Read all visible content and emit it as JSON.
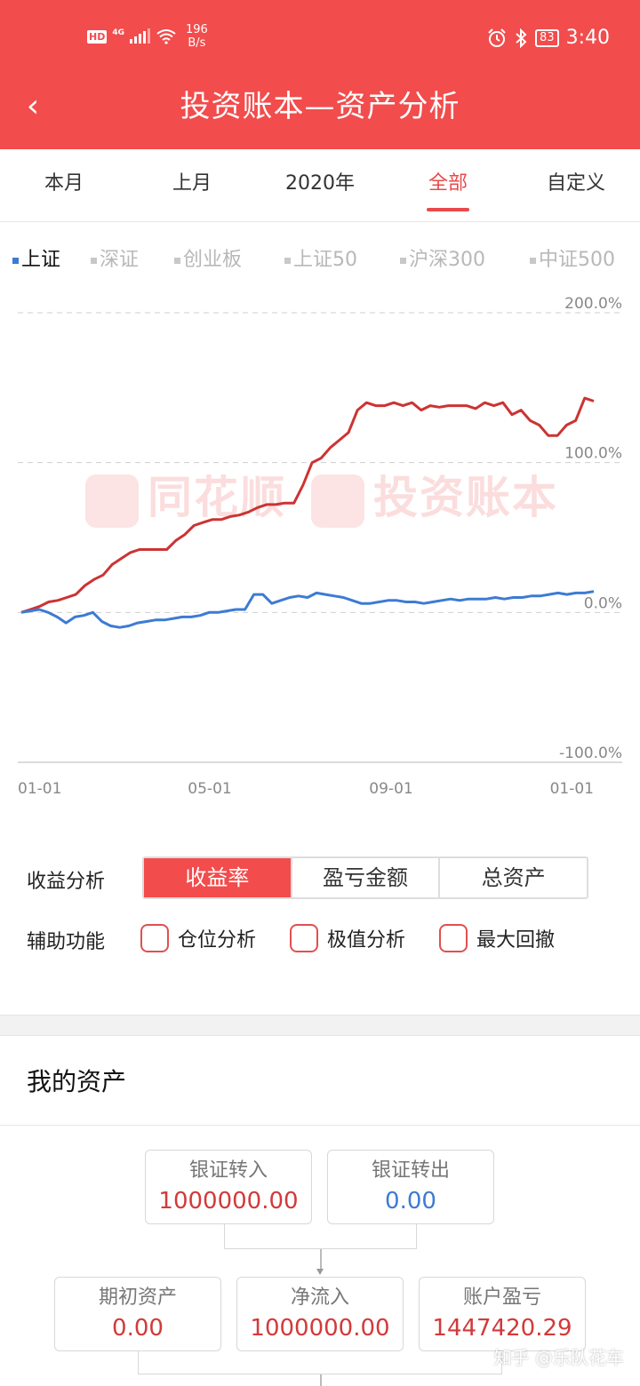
{
  "status_bar": {
    "hd": "HD",
    "network": "4G",
    "speed_value": "196",
    "speed_unit": "B/s",
    "battery": "83",
    "time": "3:40",
    "icons": [
      "alarm-icon",
      "bluetooth-icon"
    ]
  },
  "header": {
    "back_icon": "‹",
    "title": "投资账本—资产分析"
  },
  "period_tabs": [
    {
      "label": "本月"
    },
    {
      "label": "上月"
    },
    {
      "label": "2020年"
    },
    {
      "label": "全部",
      "active": true
    },
    {
      "label": "自定义"
    }
  ],
  "index_tabs": [
    {
      "label": "上证",
      "active": true
    },
    {
      "label": "深证"
    },
    {
      "label": "创业板"
    },
    {
      "label": "上证50"
    },
    {
      "label": "沪深300"
    },
    {
      "label": "中证500"
    }
  ],
  "watermark": {
    "left": "同花顺",
    "right": "投资账本"
  },
  "chart_data": {
    "type": "line",
    "x_tick_labels": [
      "01-01",
      "05-01",
      "09-01",
      "01-01"
    ],
    "y_tick_labels": [
      "200.0%",
      "100.0%",
      "0.0%",
      "-100.0%"
    ],
    "ylim": [
      -100,
      200
    ],
    "grid": true,
    "colors": {
      "account": "#cc3333",
      "index": "#3c7bd4"
    },
    "series": [
      {
        "color": "#cc3333",
        "values": [
          0,
          2,
          4,
          7,
          8,
          10,
          12,
          18,
          22,
          25,
          32,
          36,
          40,
          42,
          42,
          42,
          42,
          48,
          52,
          58,
          60,
          62,
          62,
          64,
          65,
          67,
          70,
          72,
          72,
          73,
          73,
          85,
          100,
          103,
          110,
          115,
          120,
          135,
          140,
          138,
          138,
          140,
          138,
          140,
          135,
          138,
          137,
          138,
          138,
          138,
          136,
          140,
          138,
          140,
          132,
          135,
          128,
          125,
          118,
          118,
          125,
          128,
          143,
          141
        ]
      },
      {
        "color": "#3c7bd4",
        "values": [
          0,
          1,
          2,
          0,
          -3,
          -7,
          -3,
          -2,
          0,
          -6,
          -9,
          -10,
          -9,
          -7,
          -6,
          -5,
          -5,
          -4,
          -3,
          -3,
          -2,
          0,
          0,
          1,
          2,
          2,
          12,
          12,
          6,
          8,
          10,
          11,
          10,
          13,
          12,
          11,
          10,
          8,
          6,
          6,
          7,
          8,
          8,
          7,
          7,
          6,
          7,
          8,
          9,
          8,
          9,
          9,
          9,
          10,
          9,
          10,
          10,
          11,
          11,
          12,
          13,
          12,
          13,
          13,
          14
        ]
      }
    ]
  },
  "analysis": {
    "label": "收益分析",
    "options": [
      {
        "label": "收益率",
        "active": true
      },
      {
        "label": "盈亏金额"
      },
      {
        "label": "总资产"
      }
    ]
  },
  "auxiliary": {
    "label": "辅助功能",
    "options": [
      {
        "label": "仓位分析"
      },
      {
        "label": "极值分析"
      },
      {
        "label": "最大回撤"
      }
    ]
  },
  "assets": {
    "title": "我的资产",
    "transfer_in": {
      "label": "银证转入",
      "value": "1000000.00"
    },
    "transfer_out": {
      "label": "银证转出",
      "value": "0.00"
    },
    "opening": {
      "label": "期初资产",
      "value": "0.00"
    },
    "net_inflow": {
      "label": "净流入",
      "value": "1000000.00"
    },
    "pnl": {
      "label": "账户盈亏",
      "value": "1447420.29"
    }
  },
  "credit": "知乎 @乐队花车"
}
